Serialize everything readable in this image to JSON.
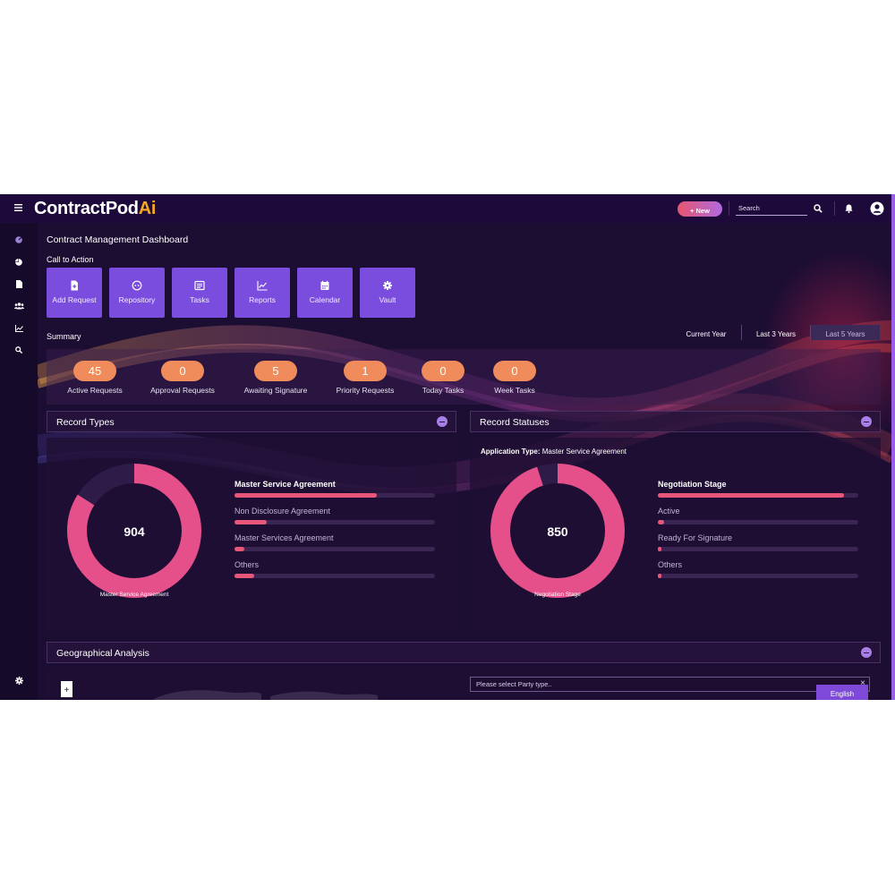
{
  "header": {
    "brand_main": "ContractPod",
    "brand_accent": "Ai",
    "new_button": "+ New",
    "search_placeholder": "Search"
  },
  "sidebar": {
    "icons": [
      "dashboard-icon",
      "pie-chart-icon",
      "document-icon",
      "users-icon",
      "line-chart-icon",
      "search-icon"
    ],
    "bottom_icon": "gear-icon"
  },
  "page": {
    "title": "Contract Management Dashboard",
    "cta_heading": "Call to Action",
    "summary_heading": "Summary"
  },
  "cta": [
    {
      "label": "Add Request",
      "icon": "file-plus-icon"
    },
    {
      "label": "Repository",
      "icon": "repository-icon"
    },
    {
      "label": "Tasks",
      "icon": "tasks-icon"
    },
    {
      "label": "Reports",
      "icon": "chart-icon"
    },
    {
      "label": "Calendar",
      "icon": "calendar-icon"
    },
    {
      "label": "Vault",
      "icon": "gear-icon"
    }
  ],
  "period_tabs": [
    {
      "label": "Current Year",
      "active": false
    },
    {
      "label": "Last 3 Years",
      "active": false
    },
    {
      "label": "Last 5 Years",
      "active": true
    }
  ],
  "summary": [
    {
      "value": "45",
      "label": "Active Requests"
    },
    {
      "value": "0",
      "label": "Approval Requests"
    },
    {
      "value": "5",
      "label": "Awaiting Signature"
    },
    {
      "value": "1",
      "label": "Priority Requests"
    },
    {
      "value": "0",
      "label": "Today Tasks"
    },
    {
      "value": "0",
      "label": "Week Tasks"
    }
  ],
  "record_types": {
    "title": "Record Types",
    "total": "904",
    "donut_label": "Master Service Agreement",
    "donut_fraction": 0.84,
    "bars": [
      {
        "label": "Master Service Agreement",
        "fraction": 0.71,
        "highlight": true
      },
      {
        "label": "Non Disclosure Agreement",
        "fraction": 0.16,
        "highlight": false
      },
      {
        "label": "Master Services Agreement",
        "fraction": 0.05,
        "highlight": false
      },
      {
        "label": "Others",
        "fraction": 0.1,
        "highlight": false
      }
    ]
  },
  "record_statuses": {
    "title": "Record Statuses",
    "application_type_label": "Application Type:",
    "application_type_value": "Master Service Agreement",
    "total": "850",
    "donut_label": "Negotiation Stage",
    "donut_fraction": 0.95,
    "bars": [
      {
        "label": "Negotiation Stage",
        "fraction": 0.93,
        "highlight": true
      },
      {
        "label": "Active",
        "fraction": 0.03,
        "highlight": false
      },
      {
        "label": "Ready For Signature",
        "fraction": 0.02,
        "highlight": false
      },
      {
        "label": "Others",
        "fraction": 0.02,
        "highlight": false
      }
    ]
  },
  "geo": {
    "title": "Geographical Analysis",
    "zoom_in": "+",
    "party_placeholder": "Please select Party type..",
    "clear": "×"
  },
  "language": "English",
  "colors": {
    "background": "#1c0d33",
    "accent_purple": "#7b4ddf",
    "accent_orange": "#f08c5c",
    "bar_pink": "#e8577a",
    "brand_accent": "#f5a623"
  }
}
